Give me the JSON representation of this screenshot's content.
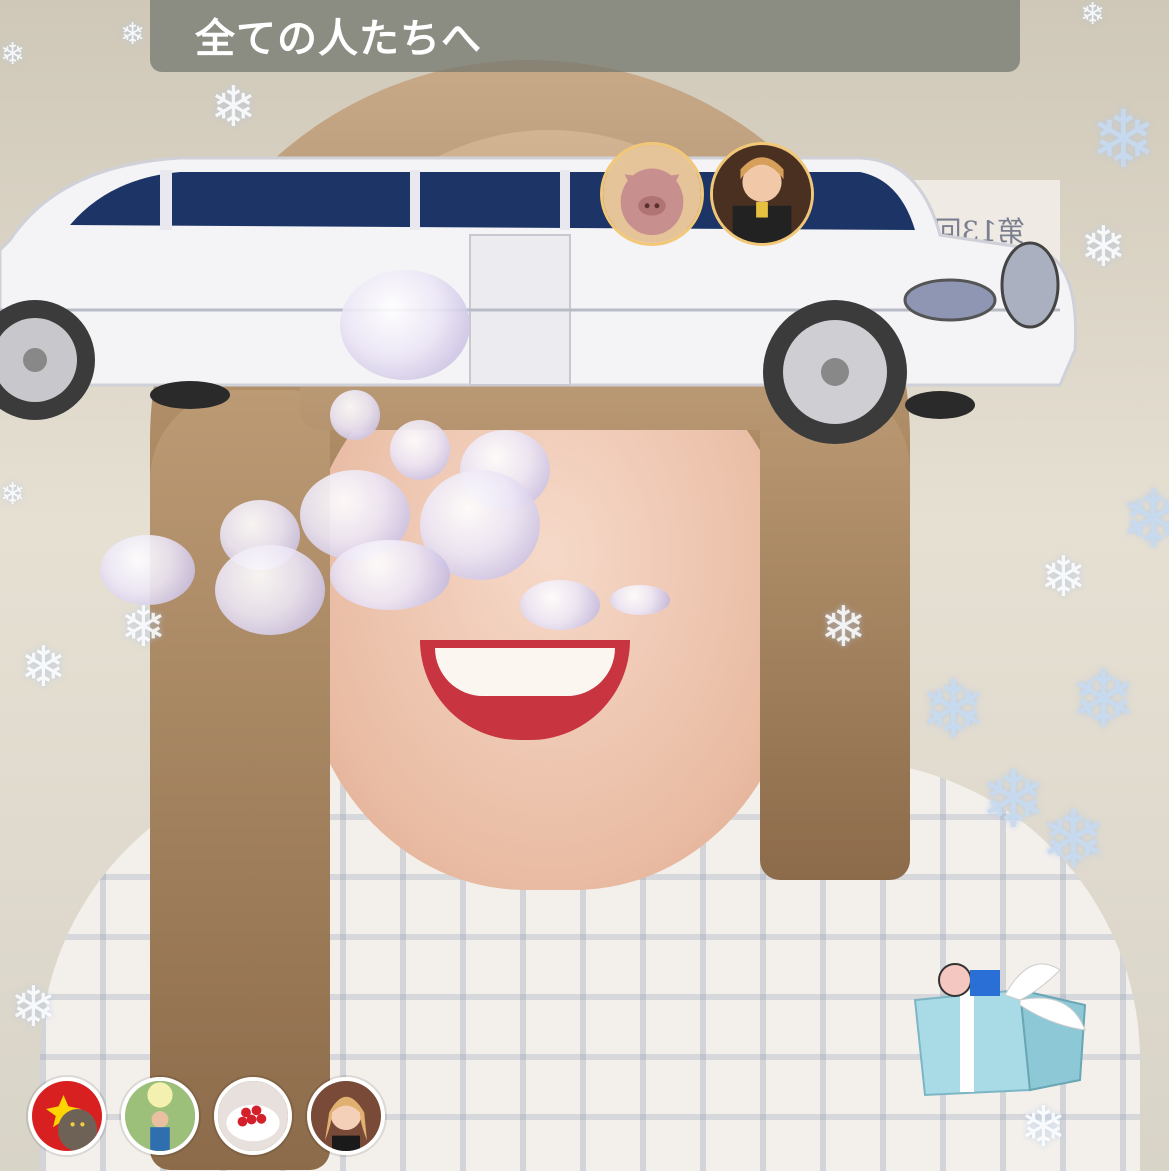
{
  "banner": {
    "text": "全ての人たちへ"
  },
  "background": {
    "poster_text": "第13回MissBe"
  },
  "top_viewers": [
    {
      "name": "pig-avatar",
      "color": "#c88f8f"
    },
    {
      "name": "woman-drink-avatar",
      "color": "#7a5038"
    }
  ],
  "bottom_viewers": [
    {
      "name": "cat-avatar",
      "color": "#d82020"
    },
    {
      "name": "outdoor-person-avatar",
      "color": "#9cc07a"
    },
    {
      "name": "cake-avatar",
      "color": "#f2ecea"
    },
    {
      "name": "woman-selfie-avatar",
      "color": "#7a4a38"
    }
  ],
  "gift": {
    "icon": "gift-box-icon"
  }
}
